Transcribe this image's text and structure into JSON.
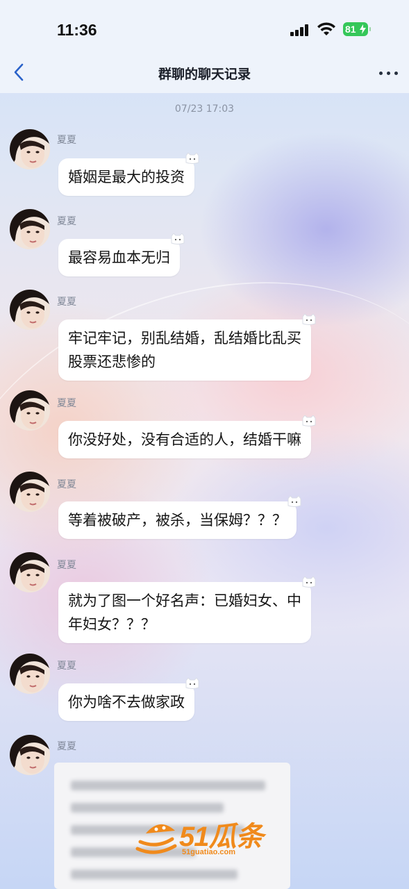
{
  "status_bar": {
    "time": "11:36",
    "battery": "81",
    "icons": [
      "signal-bars-icon",
      "wifi-icon",
      "battery-charging-icon"
    ],
    "battery_color": "#35c759"
  },
  "nav": {
    "title": "群聊的聊天记录",
    "back_icon": "chevron-left-icon",
    "more_icon": "ellipsis-icon",
    "accent": "#2a62c9"
  },
  "timestamp": "07/23 17:03",
  "messages": [
    {
      "sender": "夏夏",
      "text": "婚姻是最大的投资"
    },
    {
      "sender": "夏夏",
      "text": "最容易血本无归"
    },
    {
      "sender": "夏夏",
      "text": "牢记牢记，别乱结婚，乱结婚比乱买\n股票还悲惨的"
    },
    {
      "sender": "夏夏",
      "text": "你没好处，没有合适的人，结婚干嘛"
    },
    {
      "sender": "夏夏",
      "text": "等着被破产，被杀，当保姆？？？"
    },
    {
      "sender": "夏夏",
      "text": "就为了图一个好名声：已婚妇女、中\n年妇女？？？"
    },
    {
      "sender": "夏夏",
      "text": "你为啥不去做家政"
    },
    {
      "sender": "夏夏",
      "text": ""
    }
  ],
  "watermark": {
    "brand": "51瓜条",
    "url": "51guatiao.com",
    "color": "#f08a1c"
  }
}
